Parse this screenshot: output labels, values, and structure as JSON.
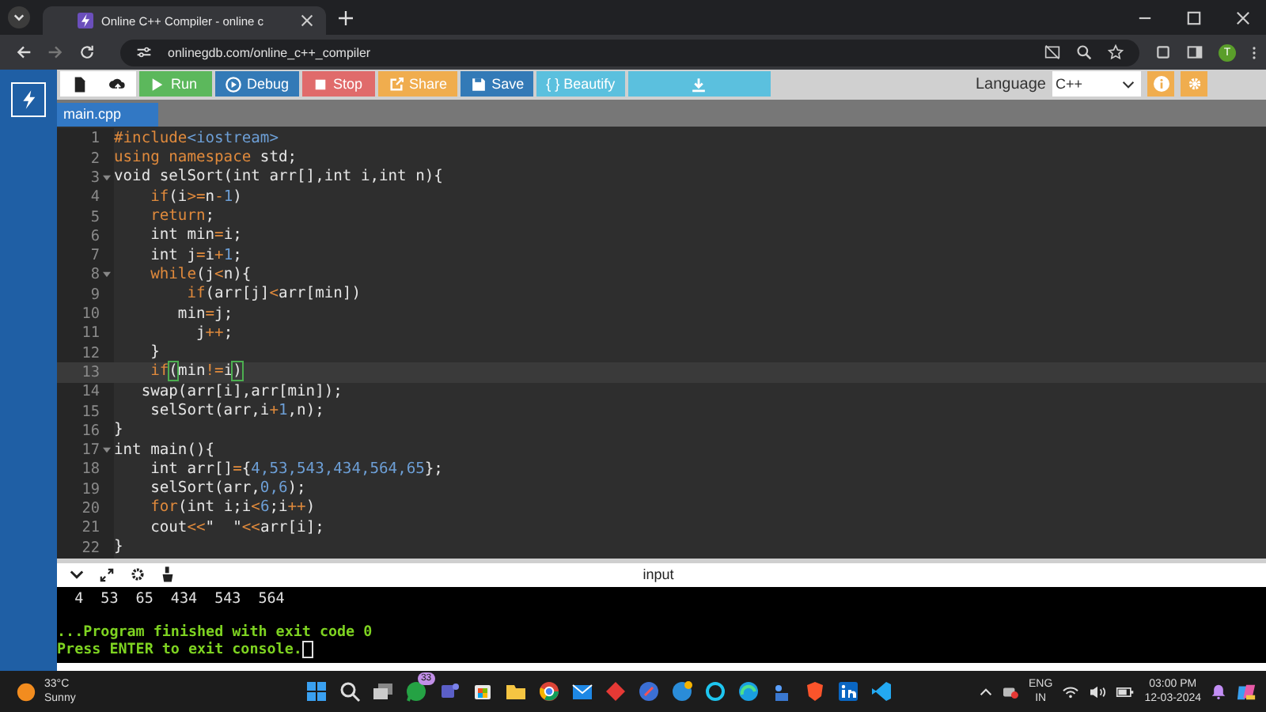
{
  "browser": {
    "tab_title": "Online C++ Compiler - online c",
    "url": "onlinegdb.com/online_c++_compiler",
    "profile_initial": "T"
  },
  "toolbar": {
    "buttons": [
      {
        "kind": "new"
      },
      {
        "kind": "upload"
      },
      {
        "kind": "run",
        "label": "Run"
      },
      {
        "kind": "debug",
        "label": "Debug"
      },
      {
        "kind": "stop",
        "label": "Stop"
      },
      {
        "kind": "share",
        "label": "Share"
      },
      {
        "kind": "save",
        "label": "Save"
      },
      {
        "kind": "beautify",
        "label": "{ } Beautify"
      },
      {
        "kind": "download"
      }
    ],
    "language_label": "Language",
    "language": "C++"
  },
  "file_tabs": [
    {
      "label": "main.cpp",
      "selected": true
    }
  ],
  "editor": {
    "lines": [
      {
        "number": "1",
        "fold": false,
        "active": false,
        "tokens": [
          {
            "kind": "keyword",
            "text": "#include"
          },
          {
            "kind": "number",
            "text": "<iostream>"
          }
        ]
      },
      {
        "number": "2",
        "fold": false,
        "active": false,
        "tokens": [
          {
            "kind": "keyword",
            "text": "using namespace"
          },
          {
            "kind": "plain",
            "text": " std;"
          }
        ]
      },
      {
        "number": "3",
        "fold": true,
        "active": false,
        "tokens": [
          {
            "kind": "plain",
            "text": "void selSort(int arr[],int i,int n){"
          }
        ]
      },
      {
        "number": "4",
        "fold": false,
        "active": false,
        "tokens": [
          {
            "kind": "keyword",
            "text": "    if"
          },
          {
            "kind": "plain",
            "text": "(i"
          },
          {
            "kind": "operator",
            "text": ">="
          },
          {
            "kind": "plain",
            "text": "n"
          },
          {
            "kind": "operator",
            "text": "-"
          },
          {
            "kind": "number",
            "text": "1"
          },
          {
            "kind": "plain",
            "text": ")"
          }
        ]
      },
      {
        "number": "5",
        "fold": false,
        "active": false,
        "tokens": [
          {
            "kind": "keyword",
            "text": "    return"
          },
          {
            "kind": "plain",
            "text": ";"
          }
        ]
      },
      {
        "number": "6",
        "fold": false,
        "active": false,
        "tokens": [
          {
            "kind": "plain",
            "text": "    int min"
          },
          {
            "kind": "operator",
            "text": "="
          },
          {
            "kind": "plain",
            "text": "i;"
          }
        ]
      },
      {
        "number": "7",
        "fold": false,
        "active": false,
        "tokens": [
          {
            "kind": "plain",
            "text": "    int j"
          },
          {
            "kind": "operator",
            "text": "="
          },
          {
            "kind": "plain",
            "text": "i"
          },
          {
            "kind": "operator",
            "text": "+"
          },
          {
            "kind": "number",
            "text": "1"
          },
          {
            "kind": "plain",
            "text": ";"
          }
        ]
      },
      {
        "number": "8",
        "fold": true,
        "active": false,
        "tokens": [
          {
            "kind": "keyword",
            "text": "    while"
          },
          {
            "kind": "plain",
            "text": "(j"
          },
          {
            "kind": "operator",
            "text": "<"
          },
          {
            "kind": "plain",
            "text": "n){"
          }
        ]
      },
      {
        "number": "9",
        "fold": false,
        "active": false,
        "tokens": [
          {
            "kind": "keyword",
            "text": "        if"
          },
          {
            "kind": "plain",
            "text": "(arr[j]"
          },
          {
            "kind": "operator",
            "text": "<"
          },
          {
            "kind": "plain",
            "text": "arr[min])"
          }
        ]
      },
      {
        "number": "10",
        "fold": false,
        "active": false,
        "tokens": [
          {
            "kind": "plain",
            "text": "       min"
          },
          {
            "kind": "operator",
            "text": "="
          },
          {
            "kind": "plain",
            "text": "j;"
          }
        ]
      },
      {
        "number": "11",
        "fold": false,
        "active": false,
        "tokens": [
          {
            "kind": "plain",
            "text": "         j"
          },
          {
            "kind": "operator",
            "text": "++"
          },
          {
            "kind": "plain",
            "text": ";"
          }
        ]
      },
      {
        "number": "12",
        "fold": false,
        "active": false,
        "tokens": [
          {
            "kind": "plain",
            "text": "    }"
          }
        ]
      },
      {
        "number": "13",
        "fold": false,
        "active": true,
        "tokens": [
          {
            "kind": "keyword",
            "text": "    if"
          },
          {
            "kind": "bracket",
            "text": "("
          },
          {
            "kind": "plain",
            "text": "min"
          },
          {
            "kind": "operator",
            "text": "!="
          },
          {
            "kind": "plain",
            "text": "i"
          },
          {
            "kind": "bracket",
            "text": ")"
          }
        ]
      },
      {
        "number": "14",
        "fold": false,
        "active": false,
        "tokens": [
          {
            "kind": "plain",
            "text": "   swap(arr[i],arr[min]);"
          }
        ]
      },
      {
        "number": "15",
        "fold": false,
        "active": false,
        "tokens": [
          {
            "kind": "plain",
            "text": "    selSort(arr,i"
          },
          {
            "kind": "operator",
            "text": "+"
          },
          {
            "kind": "number",
            "text": "1"
          },
          {
            "kind": "plain",
            "text": ",n);"
          }
        ]
      },
      {
        "number": "16",
        "fold": false,
        "active": false,
        "tokens": [
          {
            "kind": "plain",
            "text": "}"
          }
        ]
      },
      {
        "number": "17",
        "fold": true,
        "active": false,
        "tokens": [
          {
            "kind": "plain",
            "text": "int main(){"
          }
        ]
      },
      {
        "number": "18",
        "fold": false,
        "active": false,
        "tokens": [
          {
            "kind": "plain",
            "text": "    int arr[]"
          },
          {
            "kind": "operator",
            "text": "="
          },
          {
            "kind": "plain",
            "text": "{"
          },
          {
            "kind": "number",
            "text": "4,53,543,434,564,65"
          },
          {
            "kind": "plain",
            "text": "};"
          }
        ]
      },
      {
        "number": "19",
        "fold": false,
        "active": false,
        "tokens": [
          {
            "kind": "plain",
            "text": "    selSort(arr,"
          },
          {
            "kind": "number",
            "text": "0,6"
          },
          {
            "kind": "plain",
            "text": ");"
          }
        ]
      },
      {
        "number": "20",
        "fold": false,
        "active": false,
        "tokens": [
          {
            "kind": "keyword",
            "text": "    for"
          },
          {
            "kind": "plain",
            "text": "(int i;i"
          },
          {
            "kind": "operator",
            "text": "<"
          },
          {
            "kind": "number",
            "text": "6"
          },
          {
            "kind": "plain",
            "text": ";i"
          },
          {
            "kind": "operator",
            "text": "++"
          },
          {
            "kind": "plain",
            "text": ")"
          }
        ]
      },
      {
        "number": "21",
        "fold": false,
        "active": false,
        "tokens": [
          {
            "kind": "plain",
            "text": "    cout"
          },
          {
            "kind": "operator",
            "text": "<<"
          },
          {
            "kind": "plain",
            "text": "\"  \""
          },
          {
            "kind": "operator",
            "text": "<<"
          },
          {
            "kind": "plain",
            "text": "arr[i];"
          }
        ]
      },
      {
        "number": "22",
        "fold": false,
        "active": false,
        "tokens": [
          {
            "kind": "plain",
            "text": "}"
          }
        ]
      }
    ]
  },
  "console": {
    "title": "input",
    "lines": [
      {
        "kind": "output",
        "text": "  4  53  65  434  543  564",
        "cursor": false
      },
      {
        "kind": "status",
        "text": "...Program finished with exit code 0",
        "cursor": false
      },
      {
        "kind": "prompt",
        "text": "Press ENTER to exit console.",
        "cursor": true
      }
    ]
  },
  "taskbar": {
    "temperature": "33°C",
    "weather": "Sunny",
    "whatsapp_badge": "33",
    "language": "ENG",
    "region": "IN",
    "time": "03:00 PM",
    "date": "12-03-2024"
  }
}
